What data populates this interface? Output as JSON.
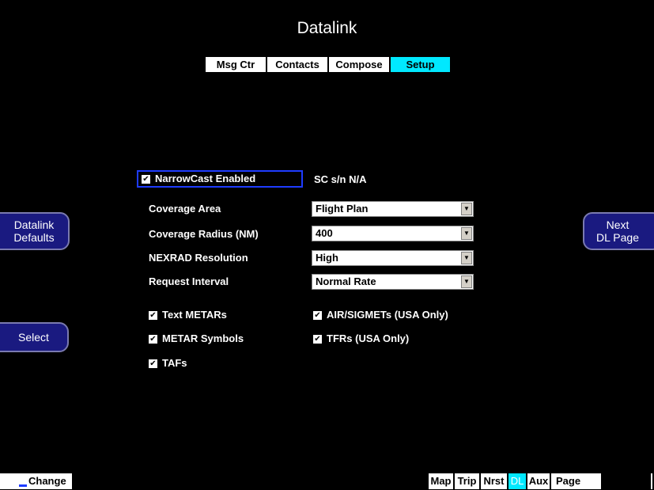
{
  "title": "Datalink",
  "tabs": [
    "Msg Ctr",
    "Contacts",
    "Compose",
    "Setup"
  ],
  "active_tab": "Setup",
  "narrowcast": {
    "label": "NarrowCast Enabled",
    "checked": true
  },
  "serial": "SC s/n N/A",
  "settings": [
    {
      "label": "Coverage Area",
      "value": "Flight Plan"
    },
    {
      "label": "Coverage Radius (NM)",
      "value": "400"
    },
    {
      "label": "NEXRAD Resolution",
      "value": "High"
    },
    {
      "label": "Request Interval",
      "value": "Normal Rate"
    }
  ],
  "options": {
    "text_metars": "Text METARs",
    "metar_symbols": "METAR Symbols",
    "tafs": "TAFs",
    "airsigmets": "AIR/SIGMETs (USA Only)",
    "tfrs": "TFRs (USA Only)"
  },
  "check_mark": "✔",
  "left_buttons": {
    "datalink_defaults": "Datalink\nDefaults",
    "select": "Select"
  },
  "right_buttons": {
    "next_dl_page": "Next\nDL Page"
  },
  "bottom": {
    "change": "Change",
    "tabs": [
      "Map",
      "Trip",
      "Nrst",
      "DL",
      "Aux",
      "Page"
    ],
    "active": "DL"
  },
  "colors": {
    "background": "#000000",
    "active_tab": "#00e8ff",
    "button": "#1a1a80",
    "focus_border": "#1e3cff"
  }
}
